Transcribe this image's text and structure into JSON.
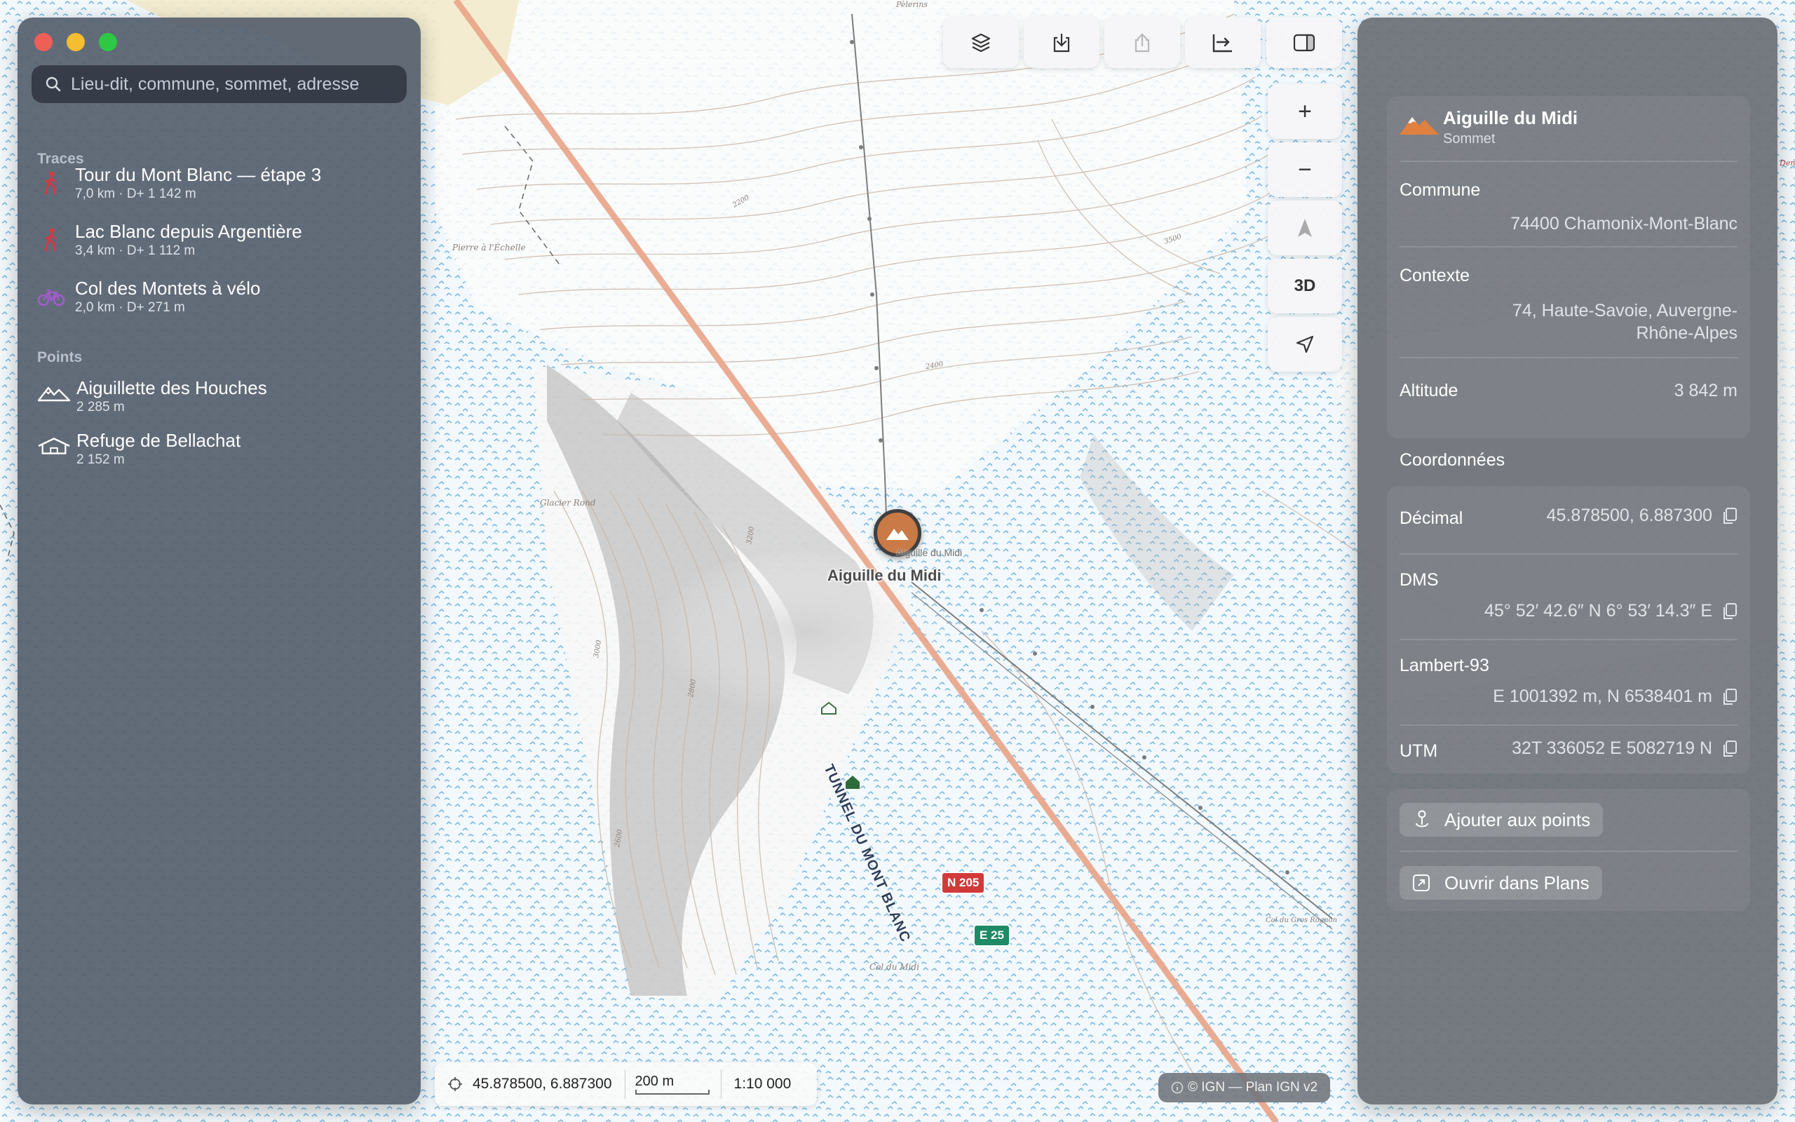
{
  "window": {
    "colors": {
      "close": "#ee5f57",
      "minimize": "#f5bd30",
      "zoom": "#2ec844"
    }
  },
  "search": {
    "placeholder": "Lieu-dit, commune, sommet, adresse",
    "icon": "search-icon"
  },
  "sidebar": {
    "traces_title": "Traces",
    "traces": [
      {
        "title": "Tour du Mont Blanc — étape 3",
        "distance": "7,0 km",
        "elevation": "D+ 1 142 m",
        "icon": "hiker-icon",
        "color": "#d23a46"
      },
      {
        "title": "Lac Blanc depuis Argentière",
        "distance": "3,4 km",
        "elevation": "D+ 1 112 m",
        "icon": "hiker-icon",
        "color": "#d23a46"
      },
      {
        "title": "Col des Montets à vélo",
        "distance": "2,0 km",
        "elevation": "D+ 271 m",
        "icon": "bike-icon",
        "color": "#a35bd1"
      }
    ],
    "points_title": "Points",
    "points": [
      {
        "title": "Aiguillette des Houches",
        "altitude": "2 285 m",
        "icon": "mountain-icon"
      },
      {
        "title": "Refuge de Bellachat",
        "altitude": "2 152 m",
        "icon": "hut-icon"
      }
    ]
  },
  "toolbar": {
    "buttons": [
      "layers-icon",
      "download-icon",
      "share-icon",
      "profile-icon",
      "sidebar-icon"
    ]
  },
  "map_controls": {
    "zoom_in": "+",
    "zoom_out": "−",
    "mode_3d": "3D"
  },
  "map": {
    "peak_label": "Aiguille du Midi",
    "peak_label_small": "Aiguille du Midi",
    "tunnel_label": "TUNNEL DU MONT BLANC",
    "road_n": "N 205",
    "road_e": "E 25",
    "place_labels": [
      "Pierre à l'Échelle",
      "Glacier Rond",
      "Col du Midi",
      "Col du Gros Rognon",
      "Pèlerins",
      "Den"
    ],
    "contour_labels": [
      "3500",
      "3200",
      "3000",
      "2800",
      "2600",
      "2400",
      "2200"
    ]
  },
  "status": {
    "coordinates": "45.878500, 6.887300",
    "scale_distance": "200 m",
    "scale_ratio": "1:10 000",
    "attribution": "© IGN — Plan IGN v2"
  },
  "panel": {
    "name": "Aiguille du Midi",
    "type": "Sommet",
    "commune_label": "Commune",
    "commune_value": "74400 Chamonix-Mont-Blanc",
    "contexte_label": "Contexte",
    "contexte_value": "74, Haute-Savoie, Auvergne-Rhône-Alpes",
    "altitude_label": "Altitude",
    "altitude_value": "3 842 m",
    "coords_title": "Coordonnées",
    "decimal_label": "Décimal",
    "decimal_value": "45.878500, 6.887300",
    "dms_label": "DMS",
    "dms_value": "45° 52′ 42.6″ N 6° 53′ 14.3″ E",
    "lambert_label": "Lambert-93",
    "lambert_value": "E 1001392 m, N 6538401 m",
    "utm_label": "UTM",
    "utm_value": "32T 336052 E 5082719 N",
    "add_button": "Ajouter aux points",
    "open_button": "Ouvrir dans Plans"
  }
}
